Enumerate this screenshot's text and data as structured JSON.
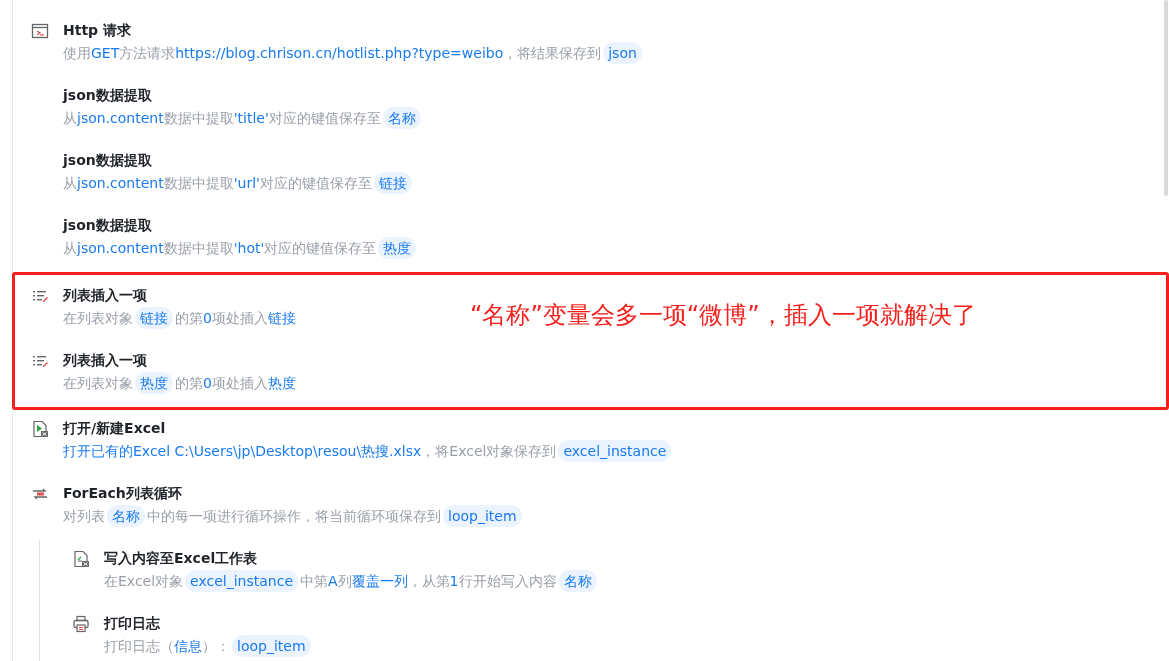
{
  "steps": [
    {
      "kind": "http",
      "title": "Http 请求",
      "description": [
        {
          "kind": "plain",
          "text": "使用"
        },
        {
          "kind": "param",
          "text": "GET"
        },
        {
          "kind": "plain",
          "text": "方法请求"
        },
        {
          "kind": "param",
          "text": "https://blog.chrison.cn/hotlist.php?type=weibo"
        },
        {
          "kind": "plain",
          "text": "，将结果保存到"
        },
        {
          "kind": "variable",
          "text": "json"
        }
      ]
    },
    {
      "kind": "json",
      "title": "json数据提取",
      "description": [
        {
          "kind": "plain",
          "text": "从"
        },
        {
          "kind": "param",
          "text": "json.content"
        },
        {
          "kind": "plain",
          "text": "数据中提取"
        },
        {
          "kind": "param",
          "text": "'title'"
        },
        {
          "kind": "plain",
          "text": "对应的键值保存至"
        },
        {
          "kind": "variable",
          "text": "名称"
        }
      ]
    },
    {
      "kind": "json",
      "title": "json数据提取",
      "description": [
        {
          "kind": "plain",
          "text": "从"
        },
        {
          "kind": "param",
          "text": "json.content"
        },
        {
          "kind": "plain",
          "text": "数据中提取"
        },
        {
          "kind": "param",
          "text": "'url'"
        },
        {
          "kind": "plain",
          "text": "对应的键值保存至"
        },
        {
          "kind": "variable",
          "text": "链接"
        }
      ]
    },
    {
      "kind": "json",
      "title": "json数据提取",
      "description": [
        {
          "kind": "plain",
          "text": "从"
        },
        {
          "kind": "param",
          "text": "json.content"
        },
        {
          "kind": "plain",
          "text": "数据中提取"
        },
        {
          "kind": "param",
          "text": "'hot'"
        },
        {
          "kind": "plain",
          "text": "对应的键值保存至"
        },
        {
          "kind": "variable",
          "text": "热度"
        }
      ]
    },
    {
      "kind": "highlight_group",
      "note": "“名称”变量会多一项“微博”，插入一项就解决了",
      "children": [
        {
          "kind": "list_insert",
          "title": "列表插入一项",
          "description": [
            {
              "kind": "plain",
              "text": "在列表对象"
            },
            {
              "kind": "variable",
              "text": "链接"
            },
            {
              "kind": "plain",
              "text": "的第"
            },
            {
              "kind": "param",
              "text": "0"
            },
            {
              "kind": "plain",
              "text": "项处插入"
            },
            {
              "kind": "param",
              "text": "链接"
            }
          ]
        },
        {
          "kind": "list_insert",
          "title": "列表插入一项",
          "description": [
            {
              "kind": "plain",
              "text": "在列表对象"
            },
            {
              "kind": "variable",
              "text": "热度"
            },
            {
              "kind": "plain",
              "text": "的第"
            },
            {
              "kind": "param",
              "text": "0"
            },
            {
              "kind": "plain",
              "text": "项处插入"
            },
            {
              "kind": "param",
              "text": "热度"
            }
          ]
        }
      ]
    },
    {
      "kind": "excel_open",
      "title": "打开/新建Excel",
      "description": [
        {
          "kind": "param",
          "text": "打开已有的Excel C:\\Users\\jp\\Desktop\\resou\\热搜.xlsx"
        },
        {
          "kind": "plain",
          "text": "，将Excel对象保存到"
        },
        {
          "kind": "variable",
          "text": "excel_instance"
        }
      ]
    },
    {
      "kind": "foreach",
      "title": "ForEach列表循环",
      "description": [
        {
          "kind": "plain",
          "text": "对列表"
        },
        {
          "kind": "variable",
          "text": "名称"
        },
        {
          "kind": "plain",
          "text": "中的每一项进行循环操作，将当前循环项保存到"
        },
        {
          "kind": "variable",
          "text": "loop_item"
        }
      ],
      "children": [
        {
          "kind": "excel_write",
          "title": "写入内容至Excel工作表",
          "description": [
            {
              "kind": "plain",
              "text": "在Excel对象"
            },
            {
              "kind": "variable",
              "text": "excel_instance"
            },
            {
              "kind": "plain",
              "text": "中第"
            },
            {
              "kind": "param",
              "text": "A"
            },
            {
              "kind": "plain",
              "text": "列"
            },
            {
              "kind": "param",
              "text": "覆盖一列"
            },
            {
              "kind": "plain",
              "text": "，从第"
            },
            {
              "kind": "param",
              "text": "1"
            },
            {
              "kind": "plain",
              "text": "行开始写入内容"
            },
            {
              "kind": "variable",
              "text": "名称"
            }
          ]
        },
        {
          "kind": "print",
          "title": "打印日志",
          "description": [
            {
              "kind": "plain",
              "text": "打印日志（"
            },
            {
              "kind": "param",
              "text": "信息"
            },
            {
              "kind": "plain",
              "text": "）："
            },
            {
              "kind": "variable",
              "text": "loop_item"
            }
          ]
        }
      ]
    }
  ]
}
